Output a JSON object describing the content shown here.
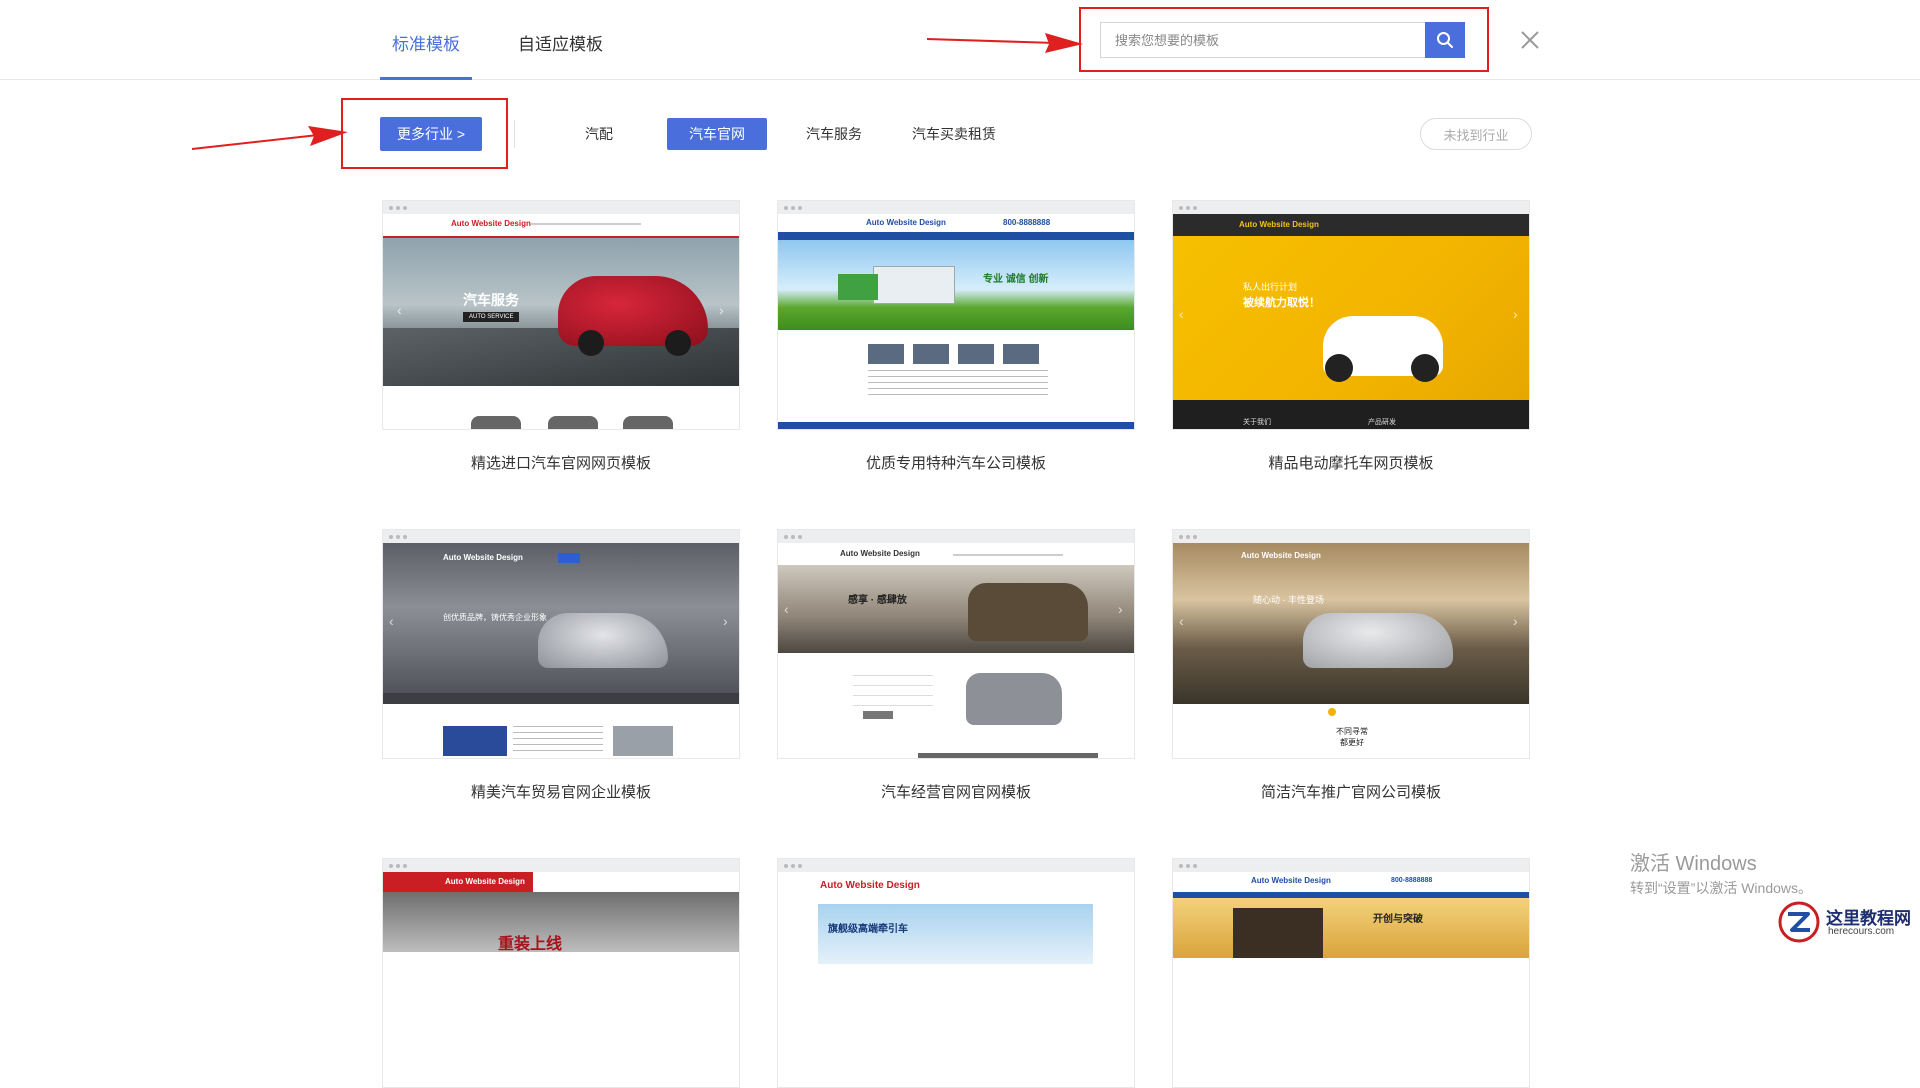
{
  "header": {
    "tabs": [
      {
        "label": "标准模板",
        "active": true
      },
      {
        "label": "自适应模板",
        "active": false
      }
    ],
    "search": {
      "placeholder": "搜索您想要的模板"
    }
  },
  "filters": {
    "more_industries": "更多行业 >",
    "categories": [
      {
        "label": "汽配",
        "active": false
      },
      {
        "label": "汽车官网",
        "active": true
      },
      {
        "label": "汽车服务",
        "active": false
      },
      {
        "label": "汽车买卖租赁",
        "active": false
      }
    ],
    "not_found": "未找到行业"
  },
  "templates": [
    {
      "title": "精选进口汽车官网网页模板"
    },
    {
      "title": "优质专用特种汽车公司模板"
    },
    {
      "title": "精品电动摩托车网页模板"
    },
    {
      "title": "精美汽车贸易官网企业模板"
    },
    {
      "title": "汽车经营官网官网模板"
    },
    {
      "title": "简洁汽车推广官网公司模板"
    },
    {
      "title": ""
    },
    {
      "title": ""
    },
    {
      "title": ""
    }
  ],
  "thumb_text": {
    "site_name": "Auto Website Design",
    "t1_heading": "汽车服务",
    "t1_sub": "AUTO SERVICE",
    "t2_heading": "专业 诚信 创新",
    "t2_phone": "800-8888888",
    "t3_heading": "私人出行计划",
    "t3_sub": "被续航力取悦！",
    "t3_about": "关于我们",
    "t3_products": "产品研发",
    "t4_heading": "创优质品牌，铸优秀企业形象",
    "t5_heading": "感享 · 感肆放",
    "t6_heading": "随心动 · 丰性登场",
    "t6_footer1": "不同寻常",
    "t6_footer2": "都更好",
    "t7_heading": "重装上线",
    "t8_heading": "旗舰级高端牵引车",
    "t9_heading": "开创与突破",
    "t9_phone": "800-8888888"
  },
  "watermark": {
    "line1": "激活 Windows",
    "line2": "转到“设置”以激活 Windows。"
  },
  "brand": {
    "name": "这里教程网",
    "url": "herecours.com"
  },
  "colors": {
    "accent": "#4a6fdc",
    "highlight": "#e02020"
  }
}
